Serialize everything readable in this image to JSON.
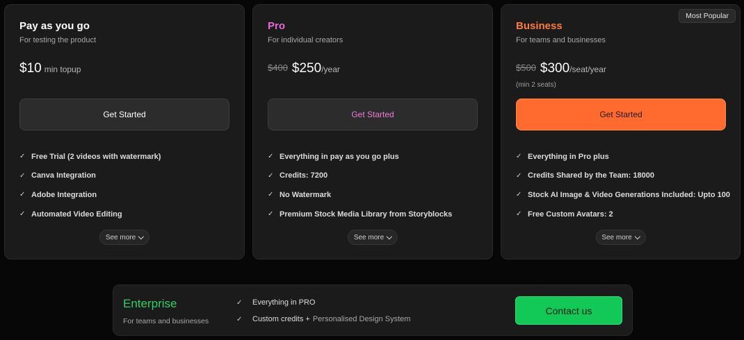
{
  "plans": [
    {
      "name": "Pay as you go",
      "subtitle": "For testing the product",
      "old_price": "",
      "price": "$10",
      "price_unit": "min topup",
      "note": "",
      "button_label": "Get Started",
      "features": [
        "Free Trial (2 videos with watermark)",
        "Canva Integration",
        "Adobe Integration",
        "Automated Video Editing"
      ],
      "see_more": "See more"
    },
    {
      "name": "Pro",
      "subtitle": "For individual creators",
      "old_price": "$400",
      "price": "$250",
      "price_unit": "/year",
      "note": "",
      "button_label": "Get Started",
      "features": [
        "Everything in pay as you go plus",
        "Credits: 7200",
        "No Watermark",
        "Premium Stock Media Library from Storyblocks"
      ],
      "see_more": "See more"
    },
    {
      "name": "Business",
      "subtitle": "For teams and businesses",
      "badge": "Most Popular",
      "old_price": "$500",
      "price": "$300",
      "price_unit": "/seat/year",
      "note": "(min 2 seats)",
      "button_label": "Get Started",
      "features": [
        "Everything in Pro plus",
        "Credits Shared by the Team: 18000",
        "Stock AI Image & Video Generations Included: Upto 100",
        "Free Custom Avatars: 2"
      ],
      "see_more": "See more"
    }
  ],
  "enterprise": {
    "name": "Enterprise",
    "subtitle": "For teams and businesses",
    "features": [
      {
        "text": "Everything in PRO",
        "extra": ""
      },
      {
        "text": "Custom credits +",
        "extra": "Personalised Design System"
      }
    ],
    "button_label": "Contact us"
  },
  "colors": {
    "pro_accent": "#e86ad8",
    "business_accent": "#ff6b2f",
    "enterprise_accent": "#12c957"
  },
  "icons": {
    "check": "check-icon",
    "chevron": "chevron-down-icon"
  }
}
